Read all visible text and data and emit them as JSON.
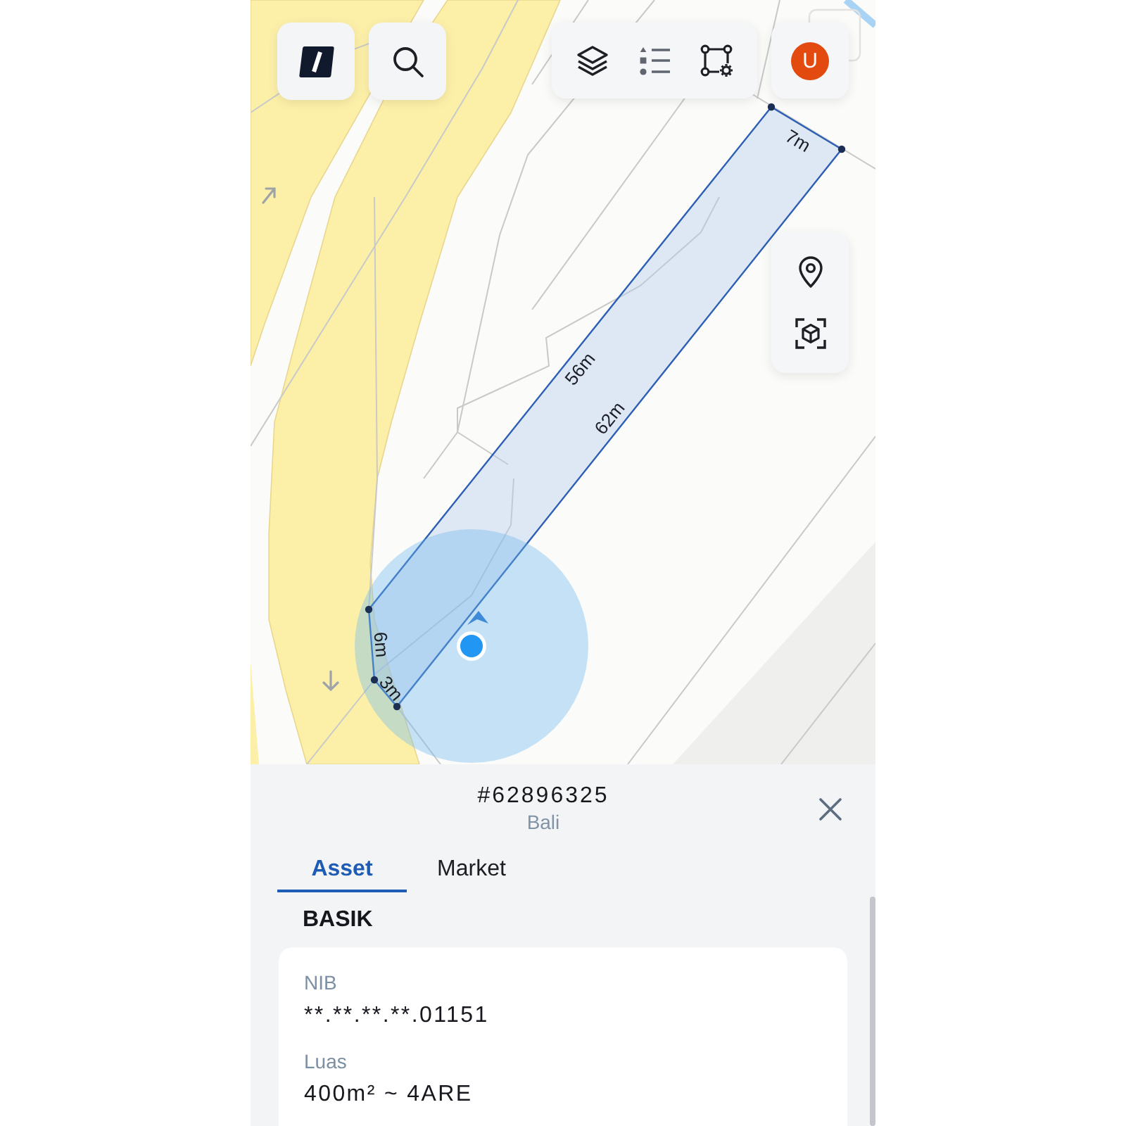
{
  "parcel": {
    "edge_labels": [
      "7m",
      "56m",
      "62m",
      "6m",
      "3m"
    ]
  },
  "avatar": {
    "initial": "U"
  },
  "sheet": {
    "title": "#62896325",
    "subtitle": "Bali",
    "tabs": [
      {
        "label": "Asset",
        "selected": true
      },
      {
        "label": "Market",
        "selected": false
      }
    ],
    "section_title": "BASIK",
    "fields": [
      {
        "label": "NIB",
        "value": "**.**.**.**.01151"
      },
      {
        "label": "Luas",
        "value": "400m² ~ 4ARE"
      }
    ]
  }
}
